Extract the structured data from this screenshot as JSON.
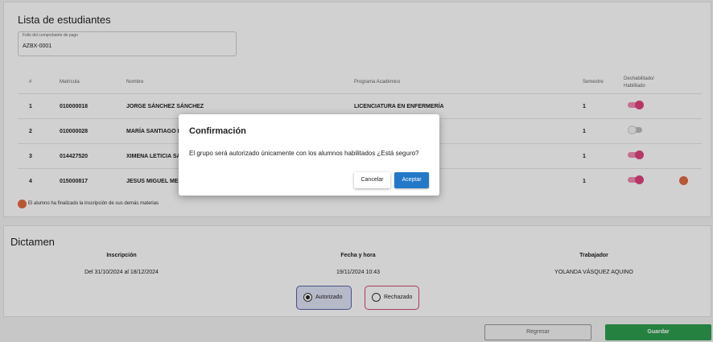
{
  "students_section": {
    "title": "Lista de estudiantes",
    "folio": {
      "label": "Folio del comprobante de pago",
      "value": "AZBX-0001"
    },
    "columns": {
      "num": "#",
      "matricula": "Matrícula",
      "nombre": "Nombre",
      "programa": "Programa Académico",
      "semestre": "Semestre",
      "estado_1": "Deshabilitado/",
      "estado_2": "Habilitado"
    },
    "rows": [
      {
        "num": "1",
        "matricula": "010000018",
        "nombre": "JORGE SÁNCHEZ SÁNCHEZ",
        "programa": "LICENCIATURA EN ENFERMERÍA",
        "semestre": "1",
        "enabled": true,
        "finalized": false
      },
      {
        "num": "2",
        "matricula": "010000028",
        "nombre": "MARÍA SANTIAGO PA",
        "programa": "",
        "semestre": "1",
        "enabled": false,
        "finalized": false
      },
      {
        "num": "3",
        "matricula": "014427520",
        "nombre": "XIMENA LETICIA SAN",
        "programa": "",
        "semestre": "1",
        "enabled": true,
        "finalized": false
      },
      {
        "num": "4",
        "matricula": "015000817",
        "nombre": "JESUS MIGUEL MEND",
        "programa": "",
        "semestre": "1",
        "enabled": true,
        "finalized": true
      }
    ],
    "legend": "El alumno ha finalizado la inscripción de sus demás materias"
  },
  "dictamen": {
    "title": "Dictamen",
    "inscripcion_label": "Inscripción",
    "inscripcion_value": "Del 31/10/2024 al 18/12/2024",
    "fecha_label": "Fecha y hora",
    "fecha_value": "19/11/2024 10:43",
    "trabajador_label": "Trabajador",
    "trabajador_value": "YOLANDA VÁSQUEZ AQUINO",
    "options": {
      "autorizado": "Autorizado",
      "rechazado": "Rechazado"
    },
    "selected": "autorizado"
  },
  "actions": {
    "regresar": "Regresar",
    "guardar": "Guardar"
  },
  "modal": {
    "title": "Confirmación",
    "message": "El grupo será autorizado únicamente con los alumnos habilitados ¿Está seguro?",
    "cancel": "Cancelar",
    "accept": "Aceptar"
  },
  "colors": {
    "toggle_on": "#e0437e",
    "finalized_dot": "#e2693f",
    "accept_button": "#2379c7",
    "save_button": "#2e9e4f"
  }
}
